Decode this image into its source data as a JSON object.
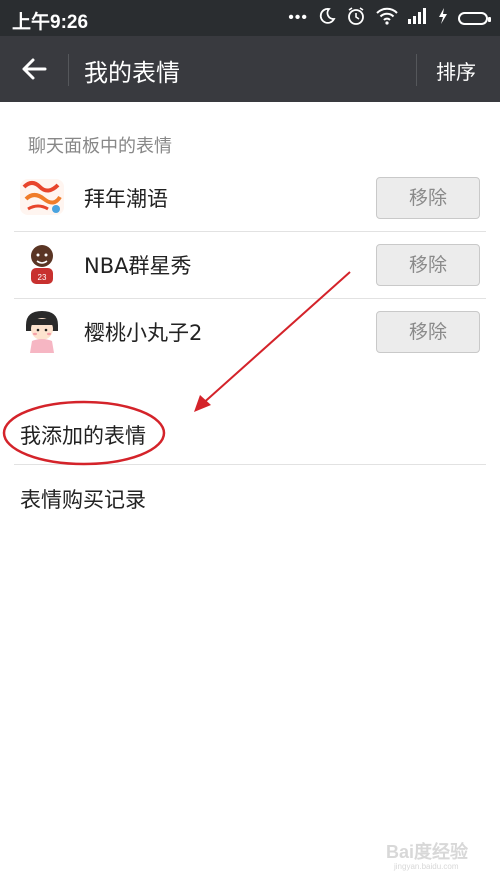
{
  "status_bar": {
    "time": "上午9:26"
  },
  "app_bar": {
    "title": "我的表情",
    "sort_label": "排序"
  },
  "section": {
    "title": "聊天面板中的表情"
  },
  "stickers": [
    {
      "name": "拜年潮语",
      "remove_label": "移除"
    },
    {
      "name": "NBA群星秀",
      "remove_label": "移除"
    },
    {
      "name": "樱桃小丸子2",
      "remove_label": "移除"
    }
  ],
  "links": {
    "my_added": "我添加的表情",
    "purchase_history": "表情购买记录"
  },
  "watermark": {
    "text": "Bai度经验",
    "url": "jingyan.baidu.com"
  },
  "colors": {
    "app_bar": "#393a3f",
    "status_bar": "#2a2d30",
    "annotation": "#d4232a"
  }
}
